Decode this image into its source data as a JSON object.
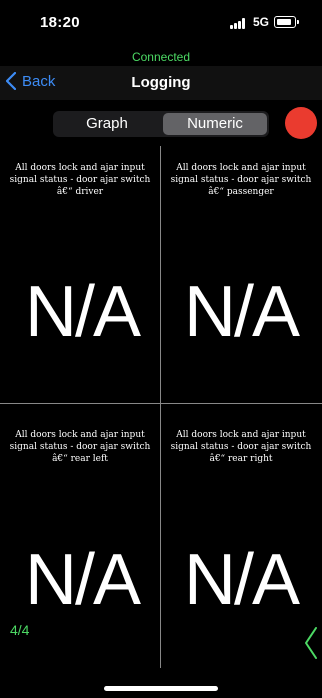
{
  "status_bar": {
    "time": "18:20",
    "network": "5G"
  },
  "connection": {
    "status": "Connected",
    "color": "#4cd964"
  },
  "navbar": {
    "back_label": "Back",
    "title": "Logging"
  },
  "segments": [
    {
      "label": "Graph",
      "selected": false
    },
    {
      "label": "Numeric",
      "selected": true
    }
  ],
  "record_button": {
    "icon": "record-icon",
    "color": "#ea3b2f"
  },
  "cells": [
    {
      "label": "All doors lock and ajar input signal status - door ajar switch â€“ driver",
      "value": "N/A"
    },
    {
      "label": "All doors lock and ajar input signal status - door ajar switch â€“ passenger",
      "value": "N/A"
    },
    {
      "label": "All doors lock and ajar input signal status - door ajar switch â€“ rear left",
      "value": "N/A"
    },
    {
      "label": "All doors lock and ajar input signal status - door ajar switch â€“ rear right",
      "value": "N/A"
    }
  ],
  "pager": {
    "text": "4/4",
    "next_icon": "chevron-left-icon"
  },
  "accent_color": "#3d8cf5"
}
